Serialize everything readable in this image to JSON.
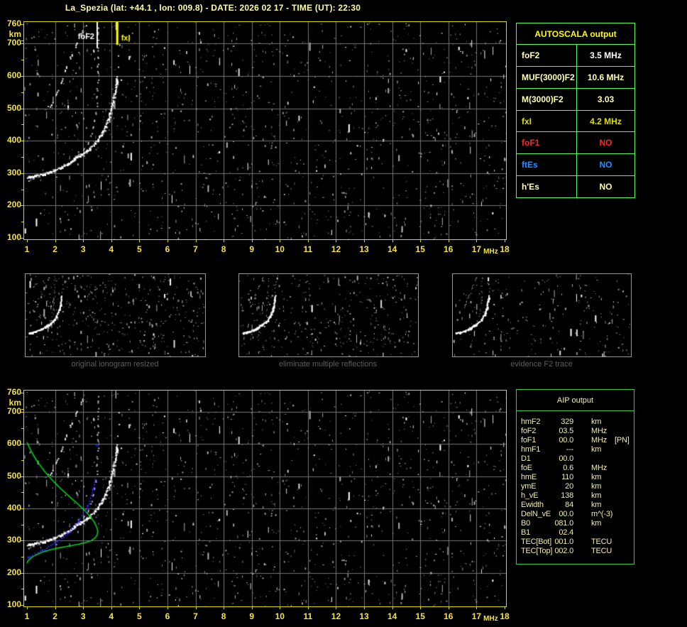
{
  "title": "La_Spezia (lat: +44.1 , lon: 009.8) - DATE:  2026 02 17  - TIME (UT):  22:30",
  "colors": {
    "title": "#ffffa6",
    "axis_label": "#f2e24a",
    "plot_border": "#d9d900",
    "grid": "#747474",
    "mini_caption": "#5f5f5f",
    "autoscala_border": "#57f857",
    "aip_border": "#3fc43f",
    "header_yellow": "#ffff00",
    "cream": "#ffffb2",
    "white": "#ffffff",
    "yellow": "#dede00",
    "red": "#ff2626",
    "blue": "#2a8cff",
    "aip_text": "#eeeeb0",
    "profile_green": "#00d018",
    "trace_blue": "#2828ff",
    "fof2_marker": "#ffffff",
    "fxi_marker": "#ffff00"
  },
  "axes": {
    "x_ticks": [
      1,
      2,
      3,
      4,
      5,
      6,
      7,
      8,
      9,
      10,
      11,
      12,
      13,
      14,
      15,
      16,
      17,
      18
    ],
    "x_unit": "MHz",
    "x_range": [
      1,
      18
    ],
    "y_ticks": [
      760,
      700,
      600,
      500,
      400,
      300,
      200,
      100
    ],
    "y_unit": "km",
    "y_range": [
      100,
      760
    ],
    "grid": true
  },
  "ionogram": {
    "type": "scatter",
    "traces": {
      "main_sweep": [
        [
          1.02,
          288
        ],
        [
          1.25,
          292
        ],
        [
          1.5,
          297
        ],
        [
          1.75,
          303
        ],
        [
          2.0,
          311
        ],
        [
          2.2,
          319
        ],
        [
          2.4,
          329
        ],
        [
          2.6,
          341
        ],
        [
          2.75,
          351
        ]
      ],
      "x_branch": [
        [
          2.75,
          351
        ],
        [
          2.95,
          360
        ],
        [
          3.15,
          372
        ],
        [
          3.35,
          388
        ],
        [
          3.55,
          410
        ],
        [
          3.72,
          436
        ],
        [
          3.87,
          466
        ],
        [
          3.98,
          498
        ],
        [
          4.07,
          532
        ],
        [
          4.14,
          566
        ],
        [
          4.19,
          598
        ]
      ],
      "x_sparse": [
        [
          4.22,
          628
        ],
        [
          4.25,
          662
        ],
        [
          4.27,
          698
        ]
      ],
      "o_branch": [
        [
          2.8,
          356
        ],
        [
          2.95,
          368
        ],
        [
          3.08,
          384
        ],
        [
          3.2,
          404
        ],
        [
          3.3,
          428
        ],
        [
          3.38,
          456
        ],
        [
          3.44,
          490
        ],
        [
          3.48,
          528
        ],
        [
          3.5,
          570
        ],
        [
          3.515,
          615
        ],
        [
          3.525,
          662
        ],
        [
          3.53,
          710
        ],
        [
          3.535,
          752
        ]
      ],
      "second_hop": [
        [
          1.82,
          505
        ],
        [
          1.95,
          528
        ],
        [
          2.08,
          556
        ],
        [
          2.22,
          588
        ],
        [
          2.36,
          620
        ],
        [
          2.5,
          650
        ],
        [
          2.64,
          678
        ],
        [
          2.78,
          704
        ],
        [
          2.9,
          726
        ],
        [
          3.0,
          744
        ],
        [
          3.1,
          758
        ]
      ]
    },
    "markers": {
      "fof2": {
        "label": "foF2",
        "freq_mhz": 3.5,
        "line_bottom_km": 686
      },
      "fxi": {
        "label": "fxI",
        "freq_mhz": 4.2,
        "line_bottom_km": 696
      }
    }
  },
  "profile": {
    "green_profile": [
      [
        1.0,
        606
      ],
      [
        1.15,
        578
      ],
      [
        1.35,
        548
      ],
      [
        1.6,
        518
      ],
      [
        1.9,
        488
      ],
      [
        2.2,
        462
      ],
      [
        2.5,
        438
      ],
      [
        2.8,
        415
      ],
      [
        3.05,
        394
      ],
      [
        3.25,
        375
      ],
      [
        3.4,
        357
      ],
      [
        3.48,
        342
      ],
      [
        3.52,
        330
      ],
      [
        3.5,
        318
      ],
      [
        3.42,
        308
      ],
      [
        3.28,
        300
      ],
      [
        3.08,
        294
      ],
      [
        2.85,
        289
      ],
      [
        2.6,
        285
      ],
      [
        2.35,
        281
      ],
      [
        2.1,
        277
      ],
      [
        1.85,
        272
      ],
      [
        1.6,
        266
      ],
      [
        1.4,
        259
      ],
      [
        1.22,
        251
      ],
      [
        1.1,
        243
      ],
      [
        1.03,
        236
      ],
      [
        1.0,
        230
      ]
    ],
    "blue_trace": [
      [
        1.02,
        250
      ],
      [
        1.18,
        257
      ],
      [
        1.38,
        265
      ],
      [
        1.6,
        275
      ],
      [
        1.82,
        286
      ],
      [
        2.05,
        299
      ],
      [
        2.28,
        314
      ],
      [
        2.5,
        331
      ],
      [
        2.7,
        350
      ],
      [
        2.88,
        371
      ],
      [
        3.05,
        394
      ],
      [
        3.18,
        418
      ],
      [
        3.28,
        443
      ],
      [
        3.36,
        468
      ],
      [
        3.42,
        492
      ]
    ],
    "blue_isolated": [
      3.49,
      598
    ]
  },
  "panels": [
    {
      "caption": "original ionogram resized"
    },
    {
      "caption": "eliminate multiple reflections"
    },
    {
      "caption": "evidence F2 trace"
    }
  ],
  "autoscala": {
    "header": "AUTOSCALA output",
    "rows": [
      {
        "label": "foF2",
        "value": "3.5 MHz",
        "label_color": "cream",
        "value_color": "white"
      },
      {
        "label": "MUF(3000)F2",
        "value": "10.6 MHz",
        "label_color": "cream",
        "value_color": "cream"
      },
      {
        "label": "M(3000)F2",
        "value": "3.03",
        "label_color": "cream",
        "value_color": "cream"
      },
      {
        "label": "fxI",
        "value": "4.2 MHz",
        "label_color": "yellow",
        "value_color": "yellow"
      },
      {
        "label": "foF1",
        "value": "NO",
        "label_color": "red",
        "value_color": "red"
      },
      {
        "label": "ftEs",
        "value": "NO",
        "label_color": "blue",
        "value_color": "blue"
      },
      {
        "label": "h'Es",
        "value": "NO",
        "label_color": "cream",
        "value_color": "cream"
      }
    ]
  },
  "aip": {
    "header": "AIP output",
    "rows": [
      {
        "label": "hmF2",
        "value": "329",
        "unit": "km",
        "extra": ""
      },
      {
        "label": "foF2",
        "value": "03.5",
        "unit": "MHz",
        "extra": ""
      },
      {
        "label": "foF1",
        "value": "00.0",
        "unit": "MHz",
        "extra": "[PN]"
      },
      {
        "label": "hmF1",
        "value": "---",
        "unit": "km",
        "extra": ""
      },
      {
        "label": "D1",
        "value": "00.0",
        "unit": "",
        "extra": ""
      },
      {
        "label": "foE",
        "value": "0.6",
        "unit": "MHz",
        "extra": ""
      },
      {
        "label": "hmE",
        "value": "110",
        "unit": "km",
        "extra": ""
      },
      {
        "label": "ymE",
        "value": "20",
        "unit": "km",
        "extra": ""
      },
      {
        "label": "h_vE",
        "value": "138",
        "unit": "km",
        "extra": ""
      },
      {
        "label": "Ewidth",
        "value": "84",
        "unit": "km",
        "extra": ""
      },
      {
        "label": "DelN_vE",
        "value": "00.0",
        "unit": "m^(-3)",
        "extra": ""
      },
      {
        "label": "B0",
        "value": "081.0",
        "unit": "km",
        "extra": ""
      },
      {
        "label": "B1",
        "value": "02.4",
        "unit": "",
        "extra": ""
      },
      {
        "label": "TEC[Bot]",
        "value": "001.0",
        "unit": "TECU",
        "extra": ""
      },
      {
        "label": "TEC[Top]",
        "value": "002.0",
        "unit": "TECU",
        "extra": ""
      }
    ]
  }
}
